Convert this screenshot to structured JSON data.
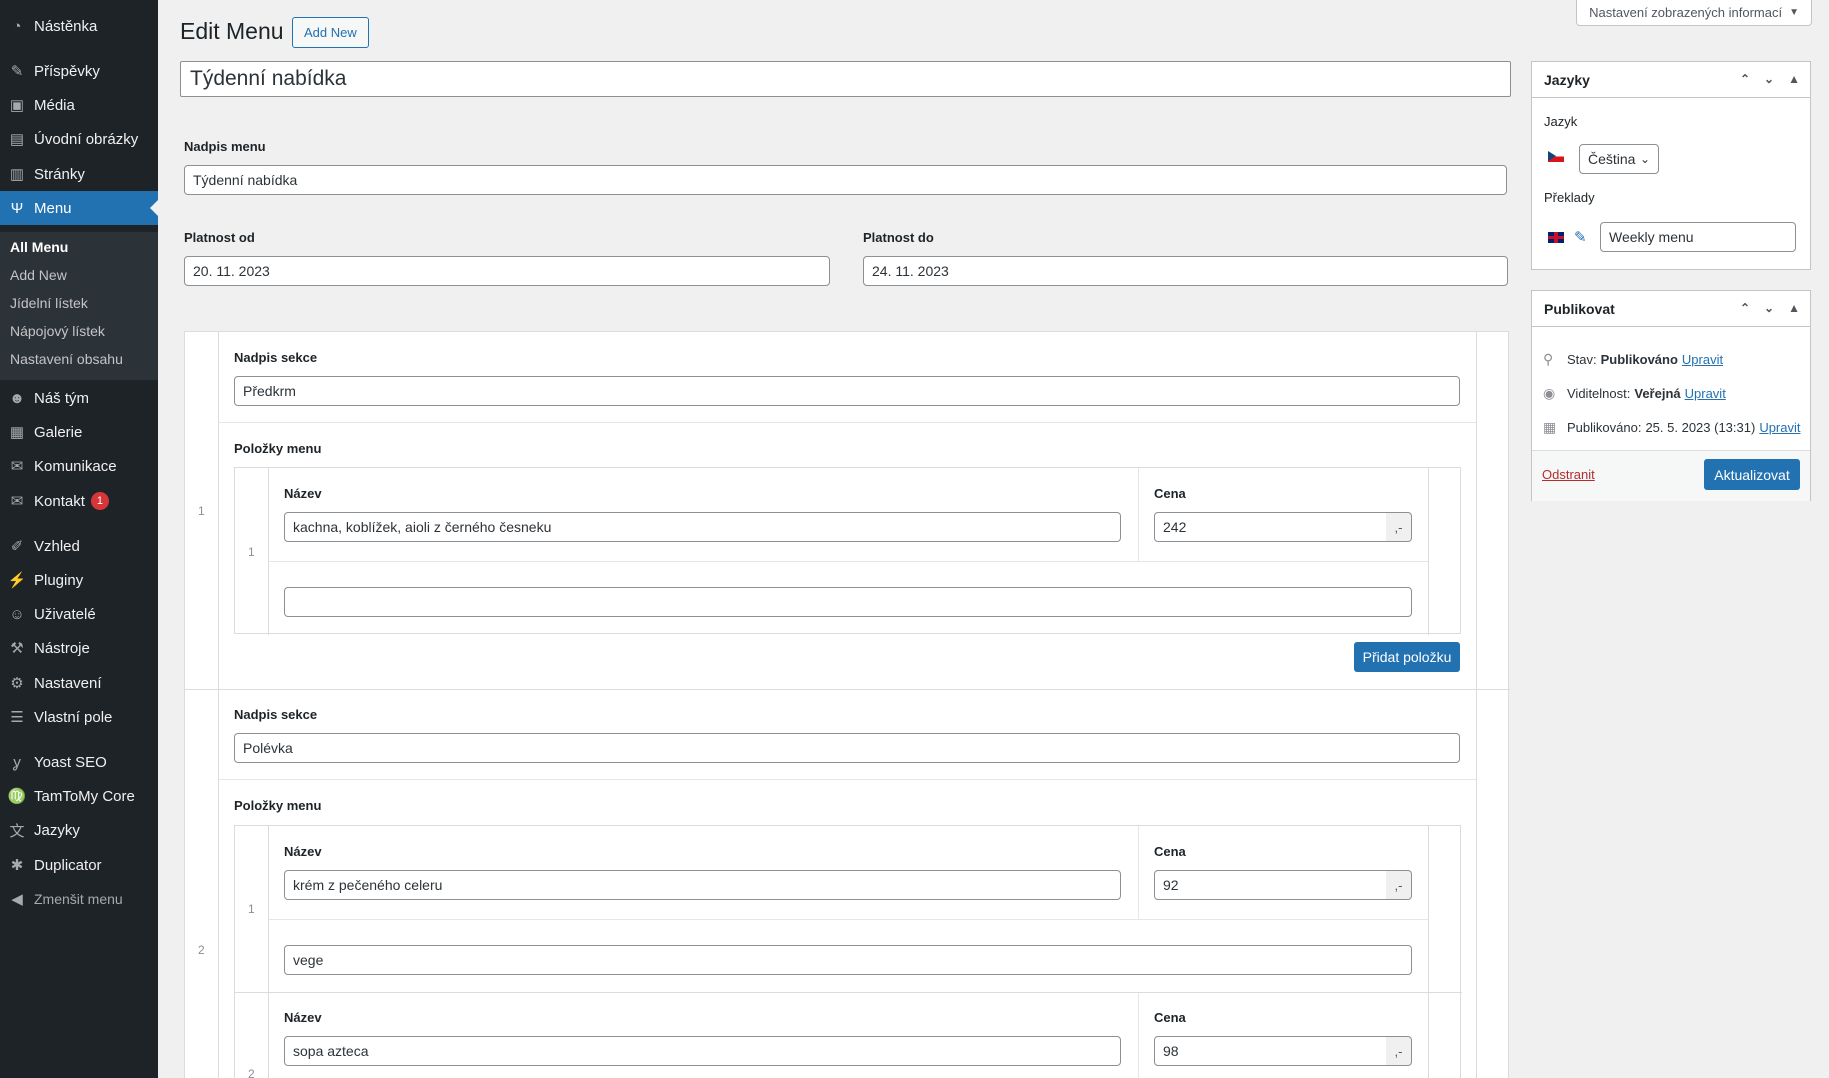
{
  "sidebar": {
    "items": [
      {
        "label": "Nástěnka",
        "icon": "dashboard-icon"
      },
      {
        "label": "Příspěvky",
        "icon": "pin-icon"
      },
      {
        "label": "Média",
        "icon": "media-icon"
      },
      {
        "label": "Úvodní obrázky",
        "icon": "slides-icon"
      },
      {
        "label": "Stránky",
        "icon": "pages-icon"
      },
      {
        "label": "Menu",
        "icon": "food-icon"
      },
      {
        "label": "Náš tým",
        "icon": "groups-icon"
      },
      {
        "label": "Galerie",
        "icon": "gallery-icon"
      },
      {
        "label": "Komunikace",
        "icon": "mail-icon"
      },
      {
        "label": "Kontakt",
        "icon": "envelope-icon",
        "badge": "1"
      },
      {
        "label": "Vzhled",
        "icon": "brush-icon"
      },
      {
        "label": "Pluginy",
        "icon": "plugin-icon"
      },
      {
        "label": "Uživatelé",
        "icon": "users-icon"
      },
      {
        "label": "Nástroje",
        "icon": "wrench-icon"
      },
      {
        "label": "Nastavení",
        "icon": "settings-icon"
      },
      {
        "label": "Vlastní pole",
        "icon": "fields-icon"
      },
      {
        "label": "Yoast SEO",
        "icon": "yoast-icon"
      },
      {
        "label": "TamToMy Core",
        "icon": "libra-icon"
      },
      {
        "label": "Jazyky",
        "icon": "translate-icon"
      },
      {
        "label": "Duplicator",
        "icon": "duplicator-icon"
      }
    ],
    "submenu": [
      "All Menu",
      "Add New",
      "Jídelní lístek",
      "Nápojový lístek",
      "Nastavení obsahu"
    ],
    "collapse_label": "Zmenšit menu"
  },
  "screen_options_label": "Nastavení zobrazených informací",
  "page": {
    "heading": "Edit Menu",
    "add_new_label": "Add New",
    "title_value": "Týdenní nabídka"
  },
  "fields": {
    "menu_title_label": "Nadpis menu",
    "menu_title_value": "Týdenní nabídka",
    "valid_from_label": "Platnost od",
    "valid_from_value": "20. 11. 2023",
    "valid_to_label": "Platnost do",
    "valid_to_value": "24. 11. 2023"
  },
  "labels": {
    "section_title": "Nadpis sekce",
    "items": "Položky menu",
    "name": "Název",
    "price": "Cena",
    "currency_suffix": ",-",
    "add_item": "Přidat položku"
  },
  "sections": [
    {
      "index": "1",
      "title": "Předkrm",
      "items": [
        {
          "index": "1",
          "name": "kachna, koblížek, aioli z černého česneku",
          "price": "242",
          "note": ""
        }
      ]
    },
    {
      "index": "2",
      "title": "Polévka",
      "items": [
        {
          "index": "1",
          "name": "krém z pečeného celeru",
          "price": "92",
          "note": "vege"
        },
        {
          "index": "2",
          "name": "sopa azteca",
          "price": "98",
          "note": ""
        }
      ]
    }
  ],
  "languages_box": {
    "title": "Jazyky",
    "language_label": "Jazyk",
    "language_value": "Čeština",
    "translations_label": "Překlady",
    "translation_value": "Weekly menu"
  },
  "publish_box": {
    "title": "Publikovat",
    "status_label": "Stav:",
    "status_value": "Publikováno",
    "visibility_label": "Viditelnost:",
    "visibility_value": "Veřejná",
    "published_label": "Publikováno:",
    "published_value": "25. 5. 2023 (13:31)",
    "edit_link": "Upravit",
    "delete_label": "Odstranit",
    "update_label": "Aktualizovat"
  },
  "colors": {
    "sidebar_bg": "#1d2327",
    "accent": "#2271b1",
    "delete": "#b32d2e"
  }
}
